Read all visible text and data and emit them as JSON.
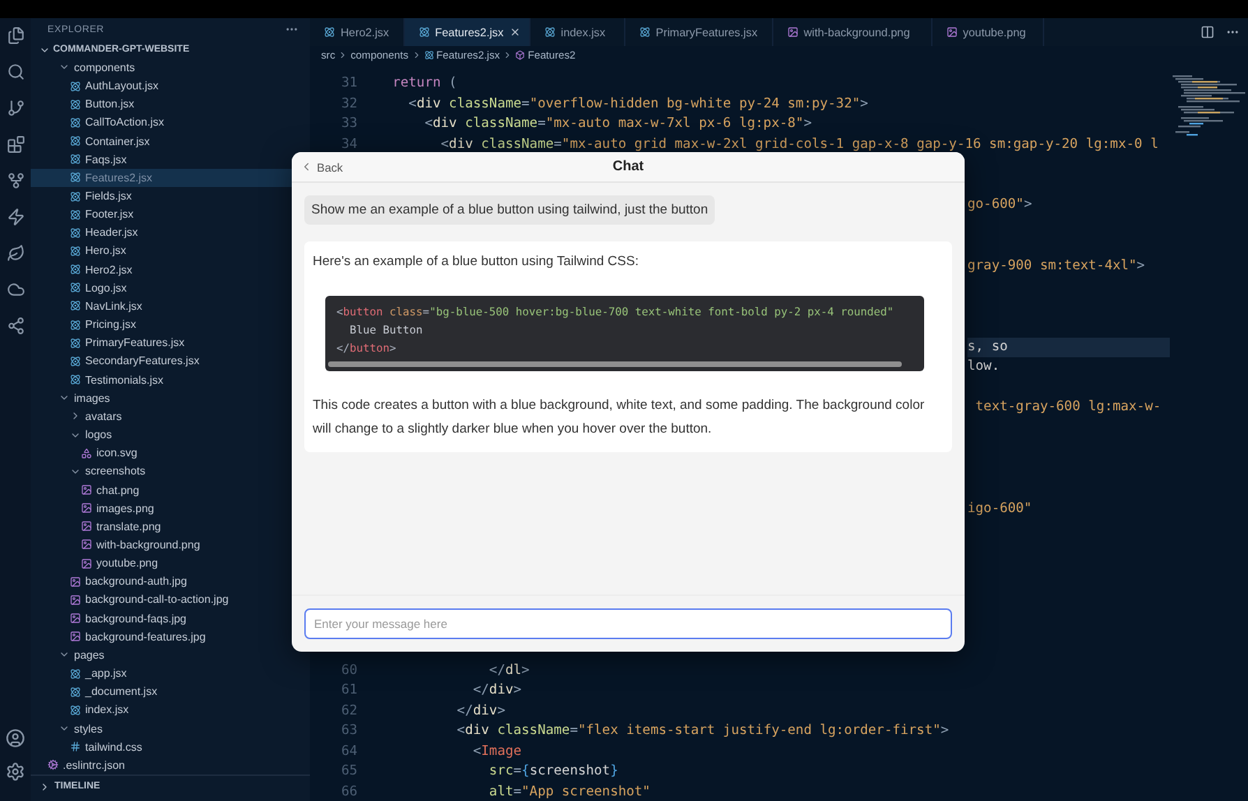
{
  "explorer": {
    "title": "EXPLORER",
    "project": "COMMANDER-GPT-WEBSITE",
    "tree": [
      {
        "name": "components",
        "kind": "folder",
        "expanded": true,
        "selected": false,
        "children": [
          {
            "name": "AuthLayout.jsx",
            "kind": "react",
            "selected": false
          },
          {
            "name": "Button.jsx",
            "kind": "react",
            "selected": false
          },
          {
            "name": "CallToAction.jsx",
            "kind": "react",
            "selected": false
          },
          {
            "name": "Container.jsx",
            "kind": "react",
            "selected": false
          },
          {
            "name": "Faqs.jsx",
            "kind": "react",
            "selected": false
          },
          {
            "name": "Features2.jsx",
            "kind": "react",
            "selected": true
          },
          {
            "name": "Fields.jsx",
            "kind": "react",
            "selected": false
          },
          {
            "name": "Footer.jsx",
            "kind": "react",
            "selected": false
          },
          {
            "name": "Header.jsx",
            "kind": "react",
            "selected": false
          },
          {
            "name": "Hero.jsx",
            "kind": "react",
            "selected": false
          },
          {
            "name": "Hero2.jsx",
            "kind": "react",
            "selected": false
          },
          {
            "name": "Logo.jsx",
            "kind": "react",
            "selected": false
          },
          {
            "name": "NavLink.jsx",
            "kind": "react",
            "selected": false
          },
          {
            "name": "Pricing.jsx",
            "kind": "react",
            "selected": false
          },
          {
            "name": "PrimaryFeatures.jsx",
            "kind": "react",
            "selected": false
          },
          {
            "name": "SecondaryFeatures.jsx",
            "kind": "react",
            "selected": false
          },
          {
            "name": "Testimonials.jsx",
            "kind": "react",
            "selected": false
          }
        ]
      },
      {
        "name": "images",
        "kind": "folder",
        "expanded": true,
        "selected": false,
        "children": [
          {
            "name": "avatars",
            "kind": "folder",
            "expanded": false,
            "selected": false
          },
          {
            "name": "logos",
            "kind": "folder",
            "expanded": true,
            "selected": false,
            "children": [
              {
                "name": "icon.svg",
                "kind": "svg",
                "selected": false
              }
            ]
          },
          {
            "name": "screenshots",
            "kind": "folder",
            "expanded": true,
            "selected": false,
            "children": [
              {
                "name": "chat.png",
                "kind": "image",
                "selected": false
              },
              {
                "name": "images.png",
                "kind": "image",
                "selected": false
              },
              {
                "name": "translate.png",
                "kind": "image",
                "selected": false
              },
              {
                "name": "with-background.png",
                "kind": "image",
                "selected": false
              },
              {
                "name": "youtube.png",
                "kind": "image",
                "selected": false
              }
            ]
          },
          {
            "name": "background-auth.jpg",
            "kind": "image",
            "selected": false
          },
          {
            "name": "background-call-to-action.jpg",
            "kind": "image",
            "selected": false
          },
          {
            "name": "background-faqs.jpg",
            "kind": "image",
            "selected": false
          },
          {
            "name": "background-features.jpg",
            "kind": "image",
            "selected": false
          }
        ]
      },
      {
        "name": "pages",
        "kind": "folder",
        "expanded": true,
        "selected": false,
        "children": [
          {
            "name": "_app.jsx",
            "kind": "react",
            "selected": false
          },
          {
            "name": "_document.jsx",
            "kind": "react",
            "selected": false
          },
          {
            "name": "index.jsx",
            "kind": "react",
            "selected": false
          }
        ]
      },
      {
        "name": "styles",
        "kind": "folder",
        "expanded": true,
        "selected": false,
        "children": [
          {
            "name": "tailwind.css",
            "kind": "css",
            "selected": false
          }
        ]
      }
    ],
    "root_files": [
      {
        "name": ".eslintrc.json",
        "kind": "config",
        "selected": false
      }
    ],
    "timeline": {
      "label": "TIMELINE",
      "expanded": false
    }
  },
  "tabs": [
    {
      "label": "Hero2.jsx",
      "kind": "react",
      "selected": false
    },
    {
      "label": "Features2.jsx",
      "kind": "react",
      "selected": true
    },
    {
      "label": "index.jsx",
      "kind": "react",
      "selected": false
    },
    {
      "label": "PrimaryFeatures.jsx",
      "kind": "react",
      "selected": false
    },
    {
      "label": "with-background.png",
      "kind": "image",
      "selected": false
    },
    {
      "label": "youtube.png",
      "kind": "image",
      "selected": false
    }
  ],
  "breadcrumb": [
    {
      "label": "src",
      "kind": "folder"
    },
    {
      "label": "components",
      "kind": "folder"
    },
    {
      "label": "Features2.jsx",
      "kind": "react"
    },
    {
      "label": "Features2",
      "kind": "symbol"
    }
  ],
  "editor": {
    "lines": [
      {
        "kind": "line",
        "number": "31",
        "current": false,
        "tokens": [
          {
            "text": "    return ",
            "kind": "kw"
          },
          {
            "text": "(",
            "kind": "punct"
          }
        ]
      },
      {
        "kind": "line",
        "number": "32",
        "current": false,
        "tokens": [
          {
            "text": "      <",
            "kind": "punct"
          },
          {
            "text": "div ",
            "kind": "tag"
          },
          {
            "text": "className",
            "kind": "attr"
          },
          {
            "text": "=",
            "kind": "punct"
          },
          {
            "text": "\"overflow-hidden bg-white py-24 sm:py-32\"",
            "kind": "str"
          },
          {
            "text": ">",
            "kind": "punct"
          }
        ]
      },
      {
        "kind": "line",
        "number": "33",
        "current": false,
        "tokens": [
          {
            "text": "        <",
            "kind": "punct"
          },
          {
            "text": "div ",
            "kind": "tag"
          },
          {
            "text": "className",
            "kind": "attr"
          },
          {
            "text": "=",
            "kind": "punct"
          },
          {
            "text": "\"mx-auto max-w-7xl px-6 lg:px-8\"",
            "kind": "str"
          },
          {
            "text": ">",
            "kind": "punct"
          }
        ]
      },
      {
        "kind": "line",
        "number": "34",
        "current": false,
        "tokens": [
          {
            "text": "          <",
            "kind": "punct"
          },
          {
            "text": "div ",
            "kind": "tag"
          },
          {
            "text": "className",
            "kind": "attr"
          },
          {
            "text": "=",
            "kind": "punct"
          },
          {
            "text": "\"mx-auto grid max-w-2xl grid-cols-1 gap-x-8 gap-y-16 sm:gap-y-20 lg:mx-0 l",
            "kind": "str"
          }
        ]
      },
      {
        "kind": "tail",
        "current": false,
        "tokens": [
          {
            "text": "go-600\"",
            "kind": "str"
          },
          {
            "text": ">",
            "kind": "punct"
          }
        ]
      },
      {
        "kind": "tail",
        "current": false,
        "tokens": [
          {
            "text": "gray-900 sm:text-4xl\"",
            "kind": "str"
          },
          {
            "text": ">",
            "kind": "punct"
          }
        ]
      },
      {
        "kind": "tail",
        "current": true,
        "tokens": [
          {
            "text": "s, so",
            "kind": "plain"
          }
        ]
      },
      {
        "kind": "tail",
        "current": false,
        "tokens": [
          {
            "text": "low.",
            "kind": "plain"
          }
        ]
      },
      {
        "kind": "tail",
        "current": false,
        "tokens": [
          {
            "text": " text-gray-600 lg:max-w-",
            "kind": "str"
          }
        ]
      },
      {
        "kind": "tail",
        "current": false,
        "tokens": [
          {
            "text": "igo-600\"",
            "kind": "str"
          }
        ]
      },
      {
        "kind": "line",
        "number": "60",
        "current": false,
        "tokens": [
          {
            "text": "                </",
            "kind": "punct"
          },
          {
            "text": "dl",
            "kind": "tag"
          },
          {
            "text": ">",
            "kind": "punct"
          }
        ]
      },
      {
        "kind": "line",
        "number": "61",
        "current": false,
        "tokens": [
          {
            "text": "              </",
            "kind": "punct"
          },
          {
            "text": "div",
            "kind": "tag"
          },
          {
            "text": ">",
            "kind": "punct"
          }
        ]
      },
      {
        "kind": "line",
        "number": "62",
        "current": false,
        "tokens": [
          {
            "text": "            </",
            "kind": "punct"
          },
          {
            "text": "div",
            "kind": "tag"
          },
          {
            "text": ">",
            "kind": "punct"
          }
        ]
      },
      {
        "kind": "line",
        "number": "63",
        "current": false,
        "tokens": [
          {
            "text": "            <",
            "kind": "punct"
          },
          {
            "text": "div ",
            "kind": "tag"
          },
          {
            "text": "className",
            "kind": "attr"
          },
          {
            "text": "=",
            "kind": "punct"
          },
          {
            "text": "\"flex items-start justify-end lg:order-first\"",
            "kind": "str"
          },
          {
            "text": ">",
            "kind": "punct"
          }
        ]
      },
      {
        "kind": "line",
        "number": "64",
        "current": false,
        "tokens": [
          {
            "text": "              <",
            "kind": "punct"
          },
          {
            "text": "Image",
            "kind": "comp"
          }
        ]
      },
      {
        "kind": "line",
        "number": "65",
        "current": false,
        "tokens": [
          {
            "text": "                src",
            "kind": "attr"
          },
          {
            "text": "=",
            "kind": "punct"
          },
          {
            "text": "{",
            "kind": "brace"
          },
          {
            "text": "screenshot",
            "kind": "plain"
          },
          {
            "text": "}",
            "kind": "brace"
          }
        ]
      },
      {
        "kind": "line",
        "number": "66",
        "current": false,
        "tokens": [
          {
            "text": "                alt",
            "kind": "attr"
          },
          {
            "text": "=",
            "kind": "punct"
          },
          {
            "text": "\"App screenshot\"",
            "kind": "str"
          }
        ]
      }
    ]
  },
  "chat": {
    "back": "Back",
    "title": "Chat",
    "messages": [
      {
        "kind": "user",
        "text": "Show me an example of a blue button using tailwind, just the button"
      },
      {
        "kind": "assistant",
        "blocks": [
          {
            "kind": "text",
            "text": "Here's an example of a blue button using Tailwind CSS:"
          },
          {
            "kind": "code",
            "lines": [
              [
                {
                  "text": "<",
                  "kind": "punct"
                },
                {
                  "text": "button ",
                  "kind": "tag"
                },
                {
                  "text": "class",
                  "kind": "attr"
                },
                {
                  "text": "=",
                  "kind": "punct"
                },
                {
                  "text": "\"bg-blue-500 hover:bg-blue-700 text-white font-bold py-2 px-4 rounded\"",
                  "kind": "str"
                }
              ],
              [
                {
                  "text": "  Blue Button",
                  "kind": "plain"
                }
              ],
              [
                {
                  "text": "</",
                  "kind": "punct"
                },
                {
                  "text": "button",
                  "kind": "tag"
                },
                {
                  "text": ">",
                  "kind": "punct"
                }
              ]
            ]
          },
          {
            "kind": "text",
            "text": "This code creates a button with a blue background, white text, and some padding. The background color will change to a slightly darker blue when you hover over the button."
          }
        ]
      }
    ],
    "input": {
      "placeholder": "Enter your message here",
      "focused": true
    }
  }
}
